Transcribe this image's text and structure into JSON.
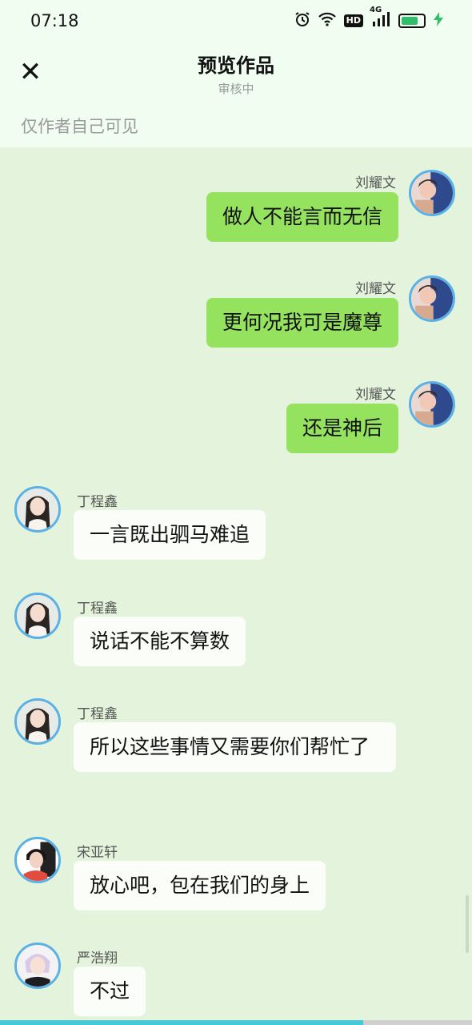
{
  "status_bar": {
    "time": "07:18",
    "hd_label": "HD",
    "network_label": "4G",
    "battery_level": 0.8
  },
  "header": {
    "title": "预览作品",
    "subtitle": "审核中",
    "close_icon": "✕"
  },
  "visibility_note": "仅作者自己可见",
  "messages": [
    {
      "side": "right",
      "sender": "刘耀文",
      "text": "做人不能言而无信"
    },
    {
      "side": "right",
      "sender": "刘耀文",
      "text": "更何况我可是魔尊"
    },
    {
      "side": "right",
      "sender": "刘耀文",
      "text": "还是神后"
    },
    {
      "side": "left",
      "sender": "丁程鑫",
      "text": "一言既出驷马难追"
    },
    {
      "side": "left",
      "sender": "丁程鑫",
      "text": "说话不能不算数"
    },
    {
      "side": "left",
      "sender": "丁程鑫",
      "text": "所以这些事情又需要你们帮忙了"
    },
    {
      "side": "left",
      "sender": "宋亚轩",
      "text": "放心吧，包在我们的身上"
    },
    {
      "side": "left",
      "sender": "严浩翔",
      "text": "不过"
    }
  ],
  "colors": {
    "accent_blue": "#5ab1e8",
    "right_bubble": "#95e25f",
    "left_bubble": "#fbfdf9",
    "background": "#e3f3dc"
  }
}
